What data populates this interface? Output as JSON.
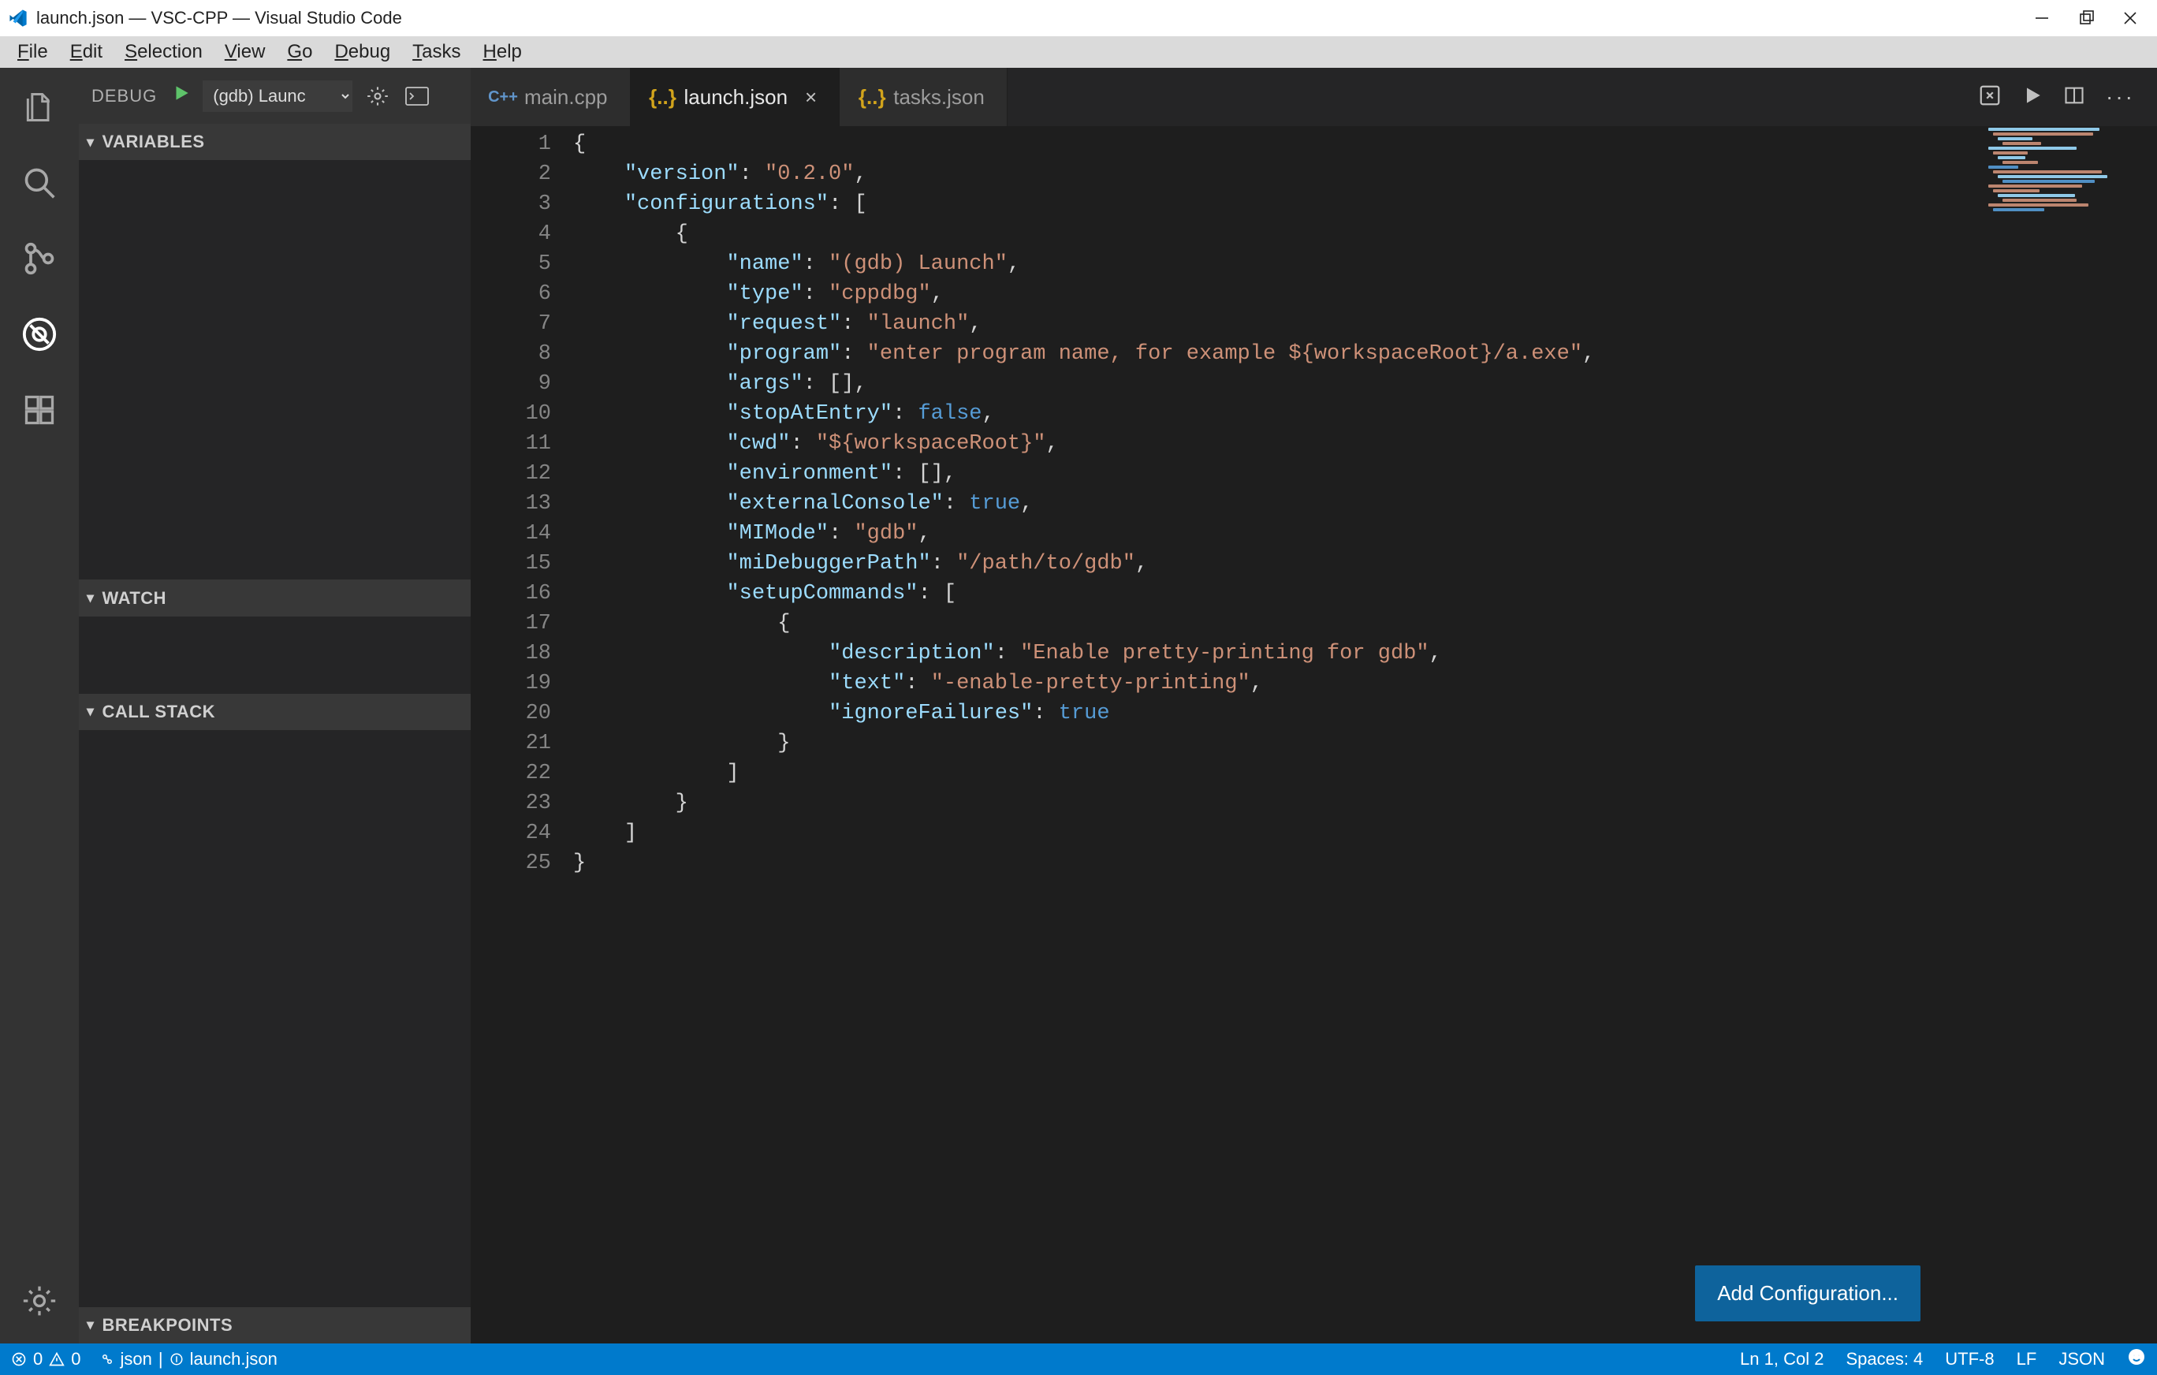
{
  "window": {
    "title": "launch.json — VSC-CPP — Visual Studio Code"
  },
  "menu": {
    "items": [
      "File",
      "Edit",
      "Selection",
      "View",
      "Go",
      "Debug",
      "Tasks",
      "Help"
    ]
  },
  "debug": {
    "label": "DEBUG",
    "config_selected": "(gdb) Launc",
    "sections": {
      "variables": "VARIABLES",
      "watch": "WATCH",
      "callstack": "CALL STACK",
      "breakpoints": "BREAKPOINTS"
    }
  },
  "tabs": [
    {
      "id": "main",
      "label": "main.cpp",
      "icon": "cpp",
      "active": false,
      "close": false
    },
    {
      "id": "launch",
      "label": "launch.json",
      "icon": "json",
      "active": true,
      "close": true
    },
    {
      "id": "tasks",
      "label": "tasks.json",
      "icon": "json",
      "active": false,
      "close": false
    }
  ],
  "editor": {
    "button_add_config": "Add Configuration...",
    "content": {
      "version": "0.2.0",
      "configurations": [
        {
          "name": "(gdb) Launch",
          "type": "cppdbg",
          "request": "launch",
          "program": "enter program name, for example ${workspaceRoot}/a.exe",
          "args": "[]",
          "stopAtEntry": "false",
          "cwd": "${workspaceRoot}",
          "environment": "[]",
          "externalConsole": "true",
          "MIMode": "gdb",
          "miDebuggerPath": "/path/to/gdb",
          "setupCommands": [
            {
              "description": "Enable pretty-printing for gdb",
              "text": "-enable-pretty-printing",
              "ignoreFailures": "true"
            }
          ]
        }
      ]
    },
    "line_count": 25
  },
  "status": {
    "errors": "0",
    "warnings": "0",
    "lang_schema": "json",
    "file": "launch.json",
    "cursor": "Ln 1, Col 2",
    "spaces": "Spaces: 4",
    "encoding": "UTF-8",
    "eol": "LF",
    "lang": "JSON"
  }
}
